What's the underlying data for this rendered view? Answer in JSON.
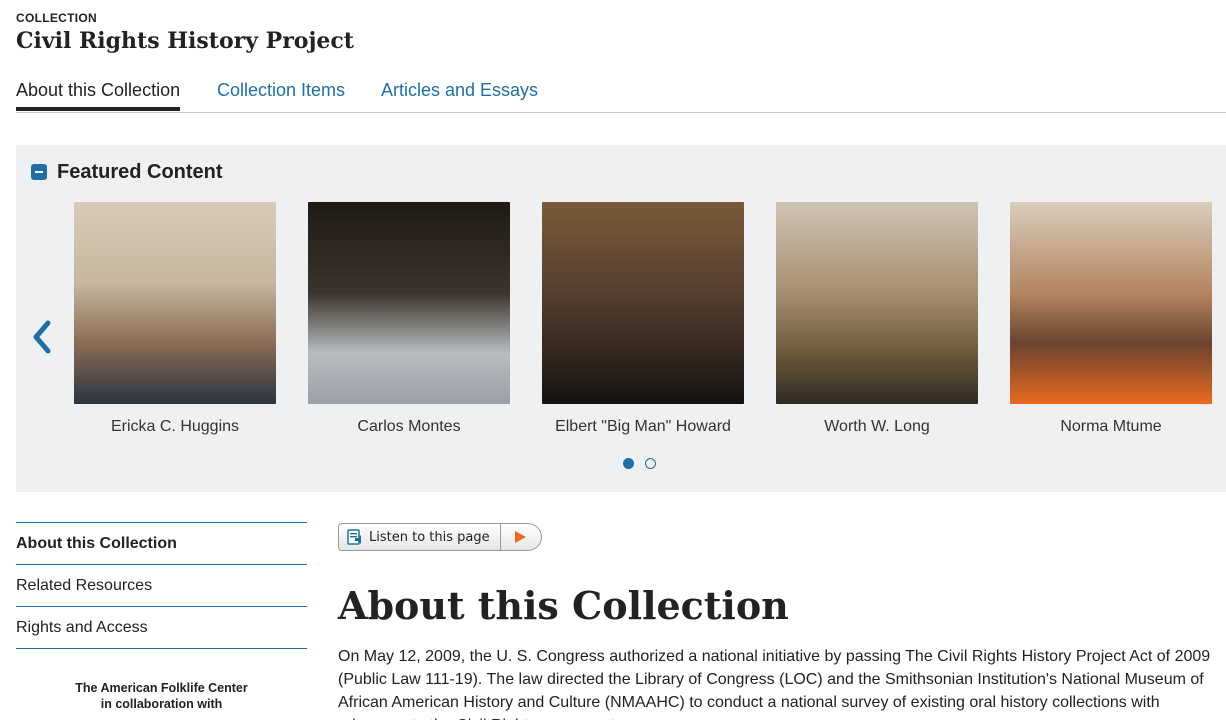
{
  "header": {
    "eyebrow": "COLLECTION",
    "title": "Civil Rights History Project"
  },
  "tabs": [
    {
      "label": "About this Collection",
      "active": true
    },
    {
      "label": "Collection Items",
      "active": false
    },
    {
      "label": "Articles and Essays",
      "active": false
    }
  ],
  "featured": {
    "title": "Featured Content",
    "cards": [
      {
        "name": "Ericka C. Huggins"
      },
      {
        "name": "Carlos Montes"
      },
      {
        "name": "Elbert \"Big Man\" Howard"
      },
      {
        "name": "Worth W. Long"
      },
      {
        "name": "Norma Mtume"
      }
    ],
    "pagination": {
      "pages": 2,
      "current": 1
    }
  },
  "sidebar": {
    "items": [
      {
        "label": "About this Collection",
        "active": true
      },
      {
        "label": "Related Resources",
        "active": false
      },
      {
        "label": "Rights and Access",
        "active": false
      }
    ],
    "partner_line1": "The American Folklife Center",
    "partner_line2": "in collaboration with"
  },
  "listen": {
    "label": "Listen to this page"
  },
  "main": {
    "title": "About this Collection",
    "paragraph": "On May 12, 2009, the U. S. Congress authorized a national initiative by passing The Civil Rights History Project Act of 2009 (Public Law 111-19). The law directed the Library of Congress (LOC) and the Smithsonian Institution's National Museum of African American History and Culture (NMAAHC) to conduct a national survey of existing oral history collections with relevance to the Civil Rights movement"
  },
  "colors": {
    "accent": "#1d6fa5",
    "play": "#e86a20",
    "panel_bg": "#eef0f1"
  }
}
